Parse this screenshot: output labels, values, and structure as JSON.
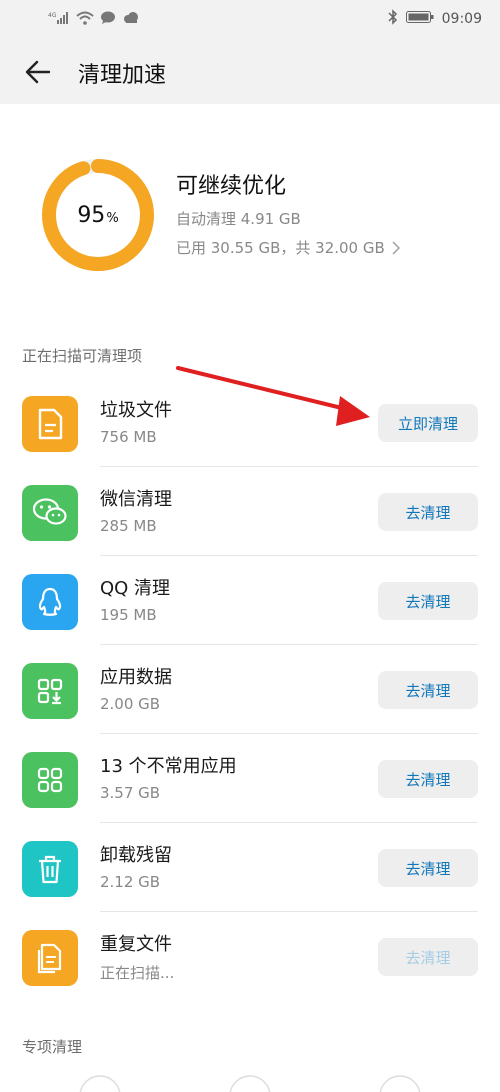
{
  "status_bar": {
    "network": "4G",
    "time": "09:09"
  },
  "header": {
    "title": "清理加速"
  },
  "summary": {
    "percent": "95",
    "percent_sign": "%",
    "percent_value": 95,
    "title": "可继续优化",
    "auto_clean": "自动清理 4.91 GB",
    "used": "已用 30.55 GB，共 32.00 GB"
  },
  "scan": {
    "label": "正在扫描可清理项",
    "items": [
      {
        "name": "垃圾文件",
        "size": "756 MB",
        "button": "立即清理",
        "icon": "document-icon",
        "color": "#f5a623"
      },
      {
        "name": "微信清理",
        "size": "285 MB",
        "button": "去清理",
        "icon": "wechat-icon",
        "color": "#4cc160"
      },
      {
        "name": "QQ 清理",
        "size": "195 MB",
        "button": "去清理",
        "icon": "qq-icon",
        "color": "#2aa6f0"
      },
      {
        "name": "应用数据",
        "size": "2.00 GB",
        "button": "去清理",
        "icon": "app-data-icon",
        "color": "#4cc160"
      },
      {
        "name": "13 个不常用应用",
        "size": "3.57 GB",
        "button": "去清理",
        "icon": "apps-grid-icon",
        "color": "#4cc160"
      },
      {
        "name": "卸载残留",
        "size": "2.12 GB",
        "button": "去清理",
        "icon": "trash-icon",
        "color": "#1fc4c4"
      },
      {
        "name": "重复文件",
        "size": "正在扫描...",
        "button": "去清理",
        "icon": "duplicate-file-icon",
        "color": "#f5a623"
      }
    ]
  },
  "special": {
    "label": "专项清理"
  },
  "colors": {
    "ring": "#f5a623",
    "button_text": "#1177bb",
    "arrow": "#e02020"
  }
}
